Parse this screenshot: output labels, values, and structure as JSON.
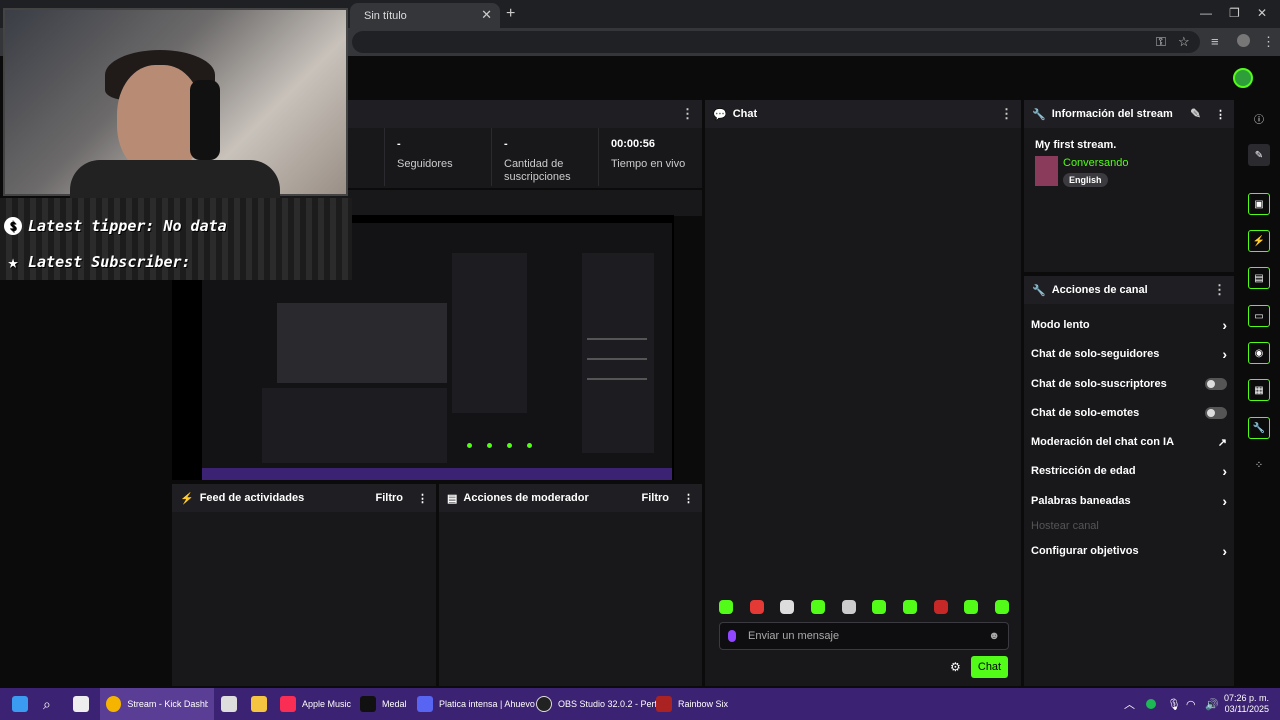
{
  "browser": {
    "tab_title": "Sin título",
    "tab_close": "✕",
    "new_tab": "+",
    "window_controls": [
      "—",
      "❐",
      "✕"
    ]
  },
  "stats": {
    "followers_value": "-",
    "followers_label": "Seguidores",
    "subs_value": "-",
    "subs_label": "Cantidad de suscripciones",
    "live_time_value": "00:00:56",
    "live_time_label": "Tiempo en vivo"
  },
  "overlay": {
    "tipper": "Latest tipper: No data",
    "subscriber": "Latest Subscriber:"
  },
  "feed": {
    "title": "Feed de actividades",
    "filter": "Filtro"
  },
  "mod_actions": {
    "title": "Acciones de moderador",
    "filter": "Filtro"
  },
  "chat": {
    "title": "Chat",
    "placeholder": "Enviar un mensaje",
    "send_label": "Chat",
    "emotes": [
      "emote-1",
      "emote-2",
      "emote-3",
      "emote-4",
      "emote-5",
      "emote-6",
      "emote-7",
      "emote-8",
      "emote-9",
      "emote-10"
    ]
  },
  "stream_info": {
    "title": "Información del stream",
    "stream_title": "My first stream.",
    "category": "Conversando",
    "language": "English"
  },
  "channel_actions": {
    "title": "Acciones de canal",
    "items": [
      {
        "label": "Modo lento",
        "control": "chevron"
      },
      {
        "label": "Chat de solo-seguidores",
        "control": "chevron"
      },
      {
        "label": "Chat de solo-suscriptores",
        "control": "toggle"
      },
      {
        "label": "Chat de solo-emotes",
        "control": "toggle"
      },
      {
        "label": "Moderación del chat con IA",
        "control": "external"
      },
      {
        "label": "Restricción de edad",
        "control": "chevron"
      },
      {
        "label": "Palabras baneadas",
        "control": "chevron"
      },
      {
        "label": "Hostear canal",
        "control": "disabled"
      },
      {
        "label": "Configurar objetivos",
        "control": "chevron"
      }
    ]
  },
  "taskbar": {
    "apps": [
      {
        "label": "Stream - Kick Dashboard",
        "icon": "chrome-icon"
      },
      {
        "label": "Apple Music",
        "icon": "apple-music-icon"
      },
      {
        "label": "Medal",
        "icon": "medal-icon"
      },
      {
        "label": "Platica intensa | Ahuevo",
        "icon": "discord-icon"
      },
      {
        "label": "OBS Studio 32.0.2 - Perf",
        "icon": "obs-icon"
      },
      {
        "label": "Rainbow Six",
        "icon": "rainbow-six-icon"
      }
    ],
    "time": "07:26 p. m.",
    "date": "03/11/2025"
  },
  "colors": {
    "accent": "#53fc18",
    "panel": "#18181b",
    "taskbar": "#3c2272"
  }
}
